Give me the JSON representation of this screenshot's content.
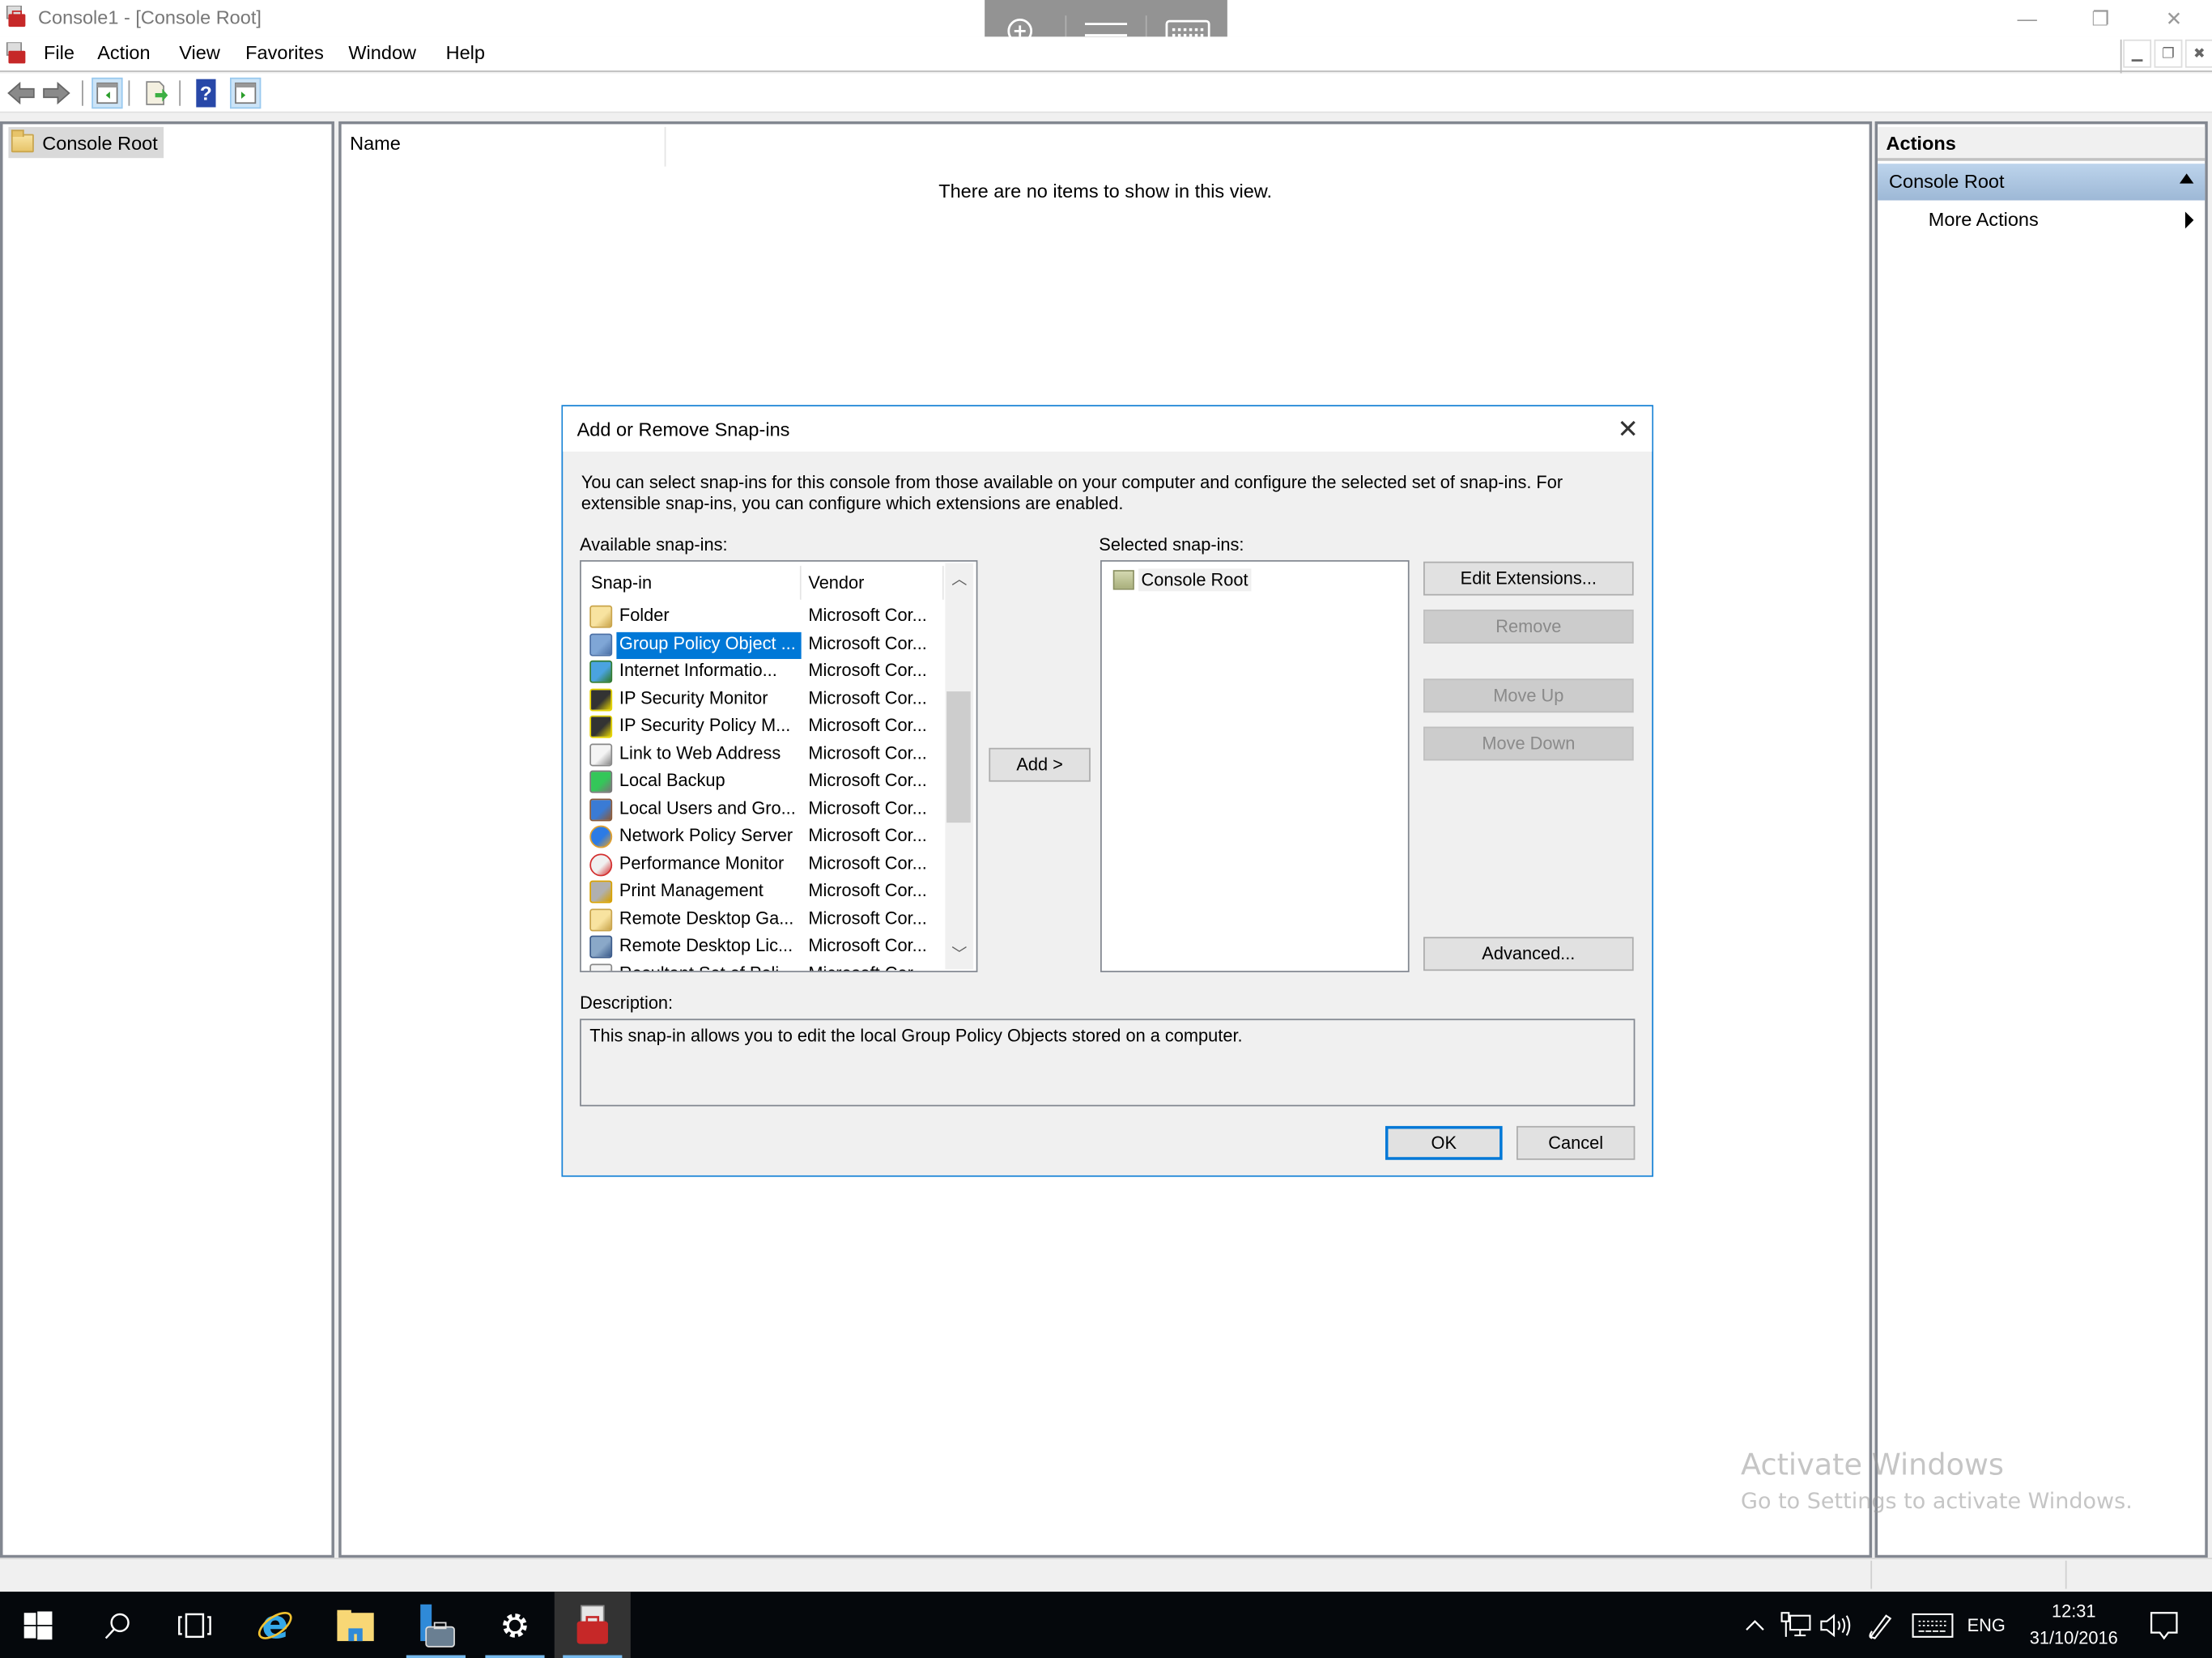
{
  "window": {
    "title": "Console1 - [Console Root]",
    "controls": {
      "minimize": "—",
      "restore": "❐",
      "close": "✕"
    }
  },
  "menubar": {
    "items": [
      "File",
      "Action",
      "View",
      "Favorites",
      "Window",
      "Help"
    ],
    "mdi_controls": {
      "minimize": "▁",
      "restore": "❐",
      "close": "✖"
    }
  },
  "toolbar": {
    "buttons": [
      "back",
      "forward",
      "show-hide-console-tree",
      "export-list",
      "help",
      "show-hide-action-pane"
    ]
  },
  "touch_overlay": {
    "buttons": [
      "zoom-in",
      "menu",
      "keyboard"
    ]
  },
  "tree": {
    "root_label": "Console Root"
  },
  "results": {
    "column_name": "Name",
    "empty_message": "There are no items to show in this view."
  },
  "actions": {
    "header": "Actions",
    "section_title": "Console Root",
    "items": [
      "More Actions"
    ]
  },
  "watermark": {
    "line1": "Activate Windows",
    "line2": "Go to Settings to activate Windows."
  },
  "dialog": {
    "title": "Add or Remove Snap-ins",
    "close": "✕",
    "intro": "You can select snap-ins for this console from those available on your computer and configure the selected set of snap-ins. For extensible snap-ins, you can configure which extensions are enabled.",
    "available_label": "Available snap-ins:",
    "selected_label": "Selected snap-ins:",
    "columns": {
      "snapin": "Snap-in",
      "vendor": "Vendor"
    },
    "available_snapins": [
      {
        "name": "Folder",
        "vendor": "Microsoft Cor...",
        "icon": "folder-icon"
      },
      {
        "name": "Group Policy Object ...",
        "vendor": "Microsoft Cor...",
        "icon": "group-policy-icon",
        "selected": true
      },
      {
        "name": "Internet Informatio...",
        "vendor": "Microsoft Cor...",
        "icon": "iis-icon"
      },
      {
        "name": "IP Security Monitor",
        "vendor": "Microsoft Cor...",
        "icon": "ip-security-icon"
      },
      {
        "name": "IP Security Policy M...",
        "vendor": "Microsoft Cor...",
        "icon": "ip-security-policy-icon"
      },
      {
        "name": "Link to Web Address",
        "vendor": "Microsoft Cor...",
        "icon": "web-link-icon"
      },
      {
        "name": "Local Backup",
        "vendor": "Microsoft Cor...",
        "icon": "backup-icon"
      },
      {
        "name": "Local Users and Gro...",
        "vendor": "Microsoft Cor...",
        "icon": "users-groups-icon"
      },
      {
        "name": "Network Policy Server",
        "vendor": "Microsoft Cor...",
        "icon": "network-policy-icon"
      },
      {
        "name": "Performance Monitor",
        "vendor": "Microsoft Cor...",
        "icon": "performance-monitor-icon"
      },
      {
        "name": "Print Management",
        "vendor": "Microsoft Cor...",
        "icon": "printer-icon"
      },
      {
        "name": "Remote Desktop Ga...",
        "vendor": "Microsoft Cor...",
        "icon": "folder-icon"
      },
      {
        "name": "Remote Desktop Lic...",
        "vendor": "Microsoft Cor...",
        "icon": "license-icon"
      },
      {
        "name": "Resultant Set of Poli...",
        "vendor": "Microsoft Cor...",
        "icon": "rsop-icon"
      }
    ],
    "selected_snapins": [
      "Console Root"
    ],
    "buttons": {
      "add": "Add >",
      "edit_extensions": "Edit Extensions...",
      "remove": "Remove",
      "move_up": "Move Up",
      "move_down": "Move Down",
      "advanced": "Advanced...",
      "ok": "OK",
      "cancel": "Cancel"
    },
    "description_label": "Description:",
    "description": "This snap-in allows you to edit the local Group Policy Objects stored on a computer."
  },
  "taskbar": {
    "apps": [
      "start",
      "search",
      "task-view",
      "internet-explorer",
      "file-explorer",
      "server-manager",
      "settings",
      "mmc"
    ],
    "tray": {
      "language": "ENG",
      "time": "12:31",
      "date": "31/10/2016"
    }
  }
}
